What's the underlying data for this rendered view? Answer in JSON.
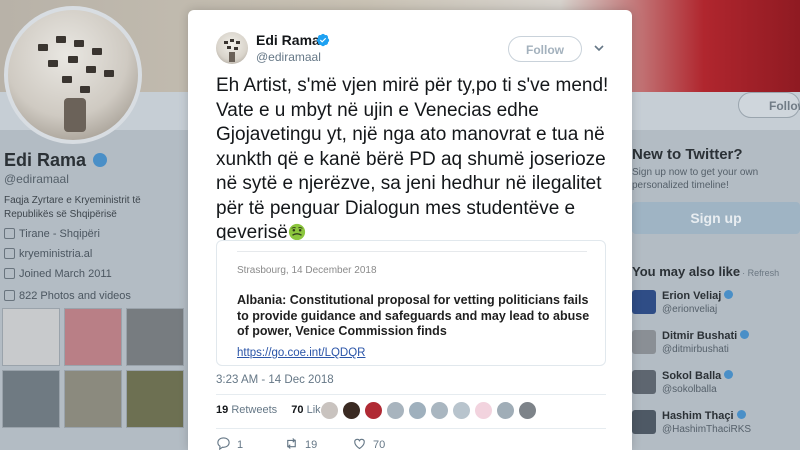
{
  "background": {
    "profile_name": "Edi Rama",
    "profile_handle": "@ediramaal",
    "bio": "Faqja Zyrtare e Kryeministrit të Republikës së Shqipërisë",
    "location": "Tirane - Shqipëri",
    "website": "kryeministria.al",
    "joined": "Joined March 2011",
    "photos": "822 Photos and videos",
    "follow_label": "Follow",
    "new_to_twitter": "New to Twitter?",
    "signup_sub": "Sign up now to get your own personalized timeline!",
    "signup_label": "Sign up",
    "you_may_also_like": "You may also like",
    "refresh_label": "· Refresh",
    "suggestions": [
      {
        "name": "Erion Veliaj",
        "handle": "@erionveliaj"
      },
      {
        "name": "Ditmir Bushati",
        "handle": "@ditmirbushati"
      },
      {
        "name": "Sokol Balla",
        "handle": "@sokolballa"
      },
      {
        "name": "Hashim Thaçi",
        "handle": "@HashimThaciRKS"
      }
    ]
  },
  "tweet": {
    "author_name": "Edi Rama",
    "author_handle": "@ediramaal",
    "follow_label": "Follow",
    "text": "Eh Artist, s'më vjen mirë për ty,po ti s've mend! Vate e u mbyt në ujin e Venecias edhe Gjojavetingu yt, një nga ato manovrat e tua në xunkth që e kanë bërë PD aq shumë joserioze në sytë e njerëzve, sa jeni hedhur në ilegalitet për të penguar Dialogun mes studentëve e qeverisë",
    "emoji": "nauseated-face-emoji",
    "link_card": {
      "date": "Strasbourg, 14 December 2018",
      "title": "Albania: Constitutional proposal for vetting politicians fails to provide guidance and safeguards and may lead to abuse of power, Venice Commission finds",
      "url": "https://go.coe.int/LQDQR"
    },
    "timestamp": "3:23 AM - 14 Dec 2018",
    "retweets_count": "19",
    "retweets_label": "Retweets",
    "likes_count": "70",
    "likes_label": "Likes",
    "actions": {
      "reply_count": "1",
      "retweet_count": "19",
      "like_count": "70"
    }
  },
  "colors": {
    "accent": "#1da1f2",
    "verified": "#1da1f2",
    "link": "#2b55a8"
  }
}
